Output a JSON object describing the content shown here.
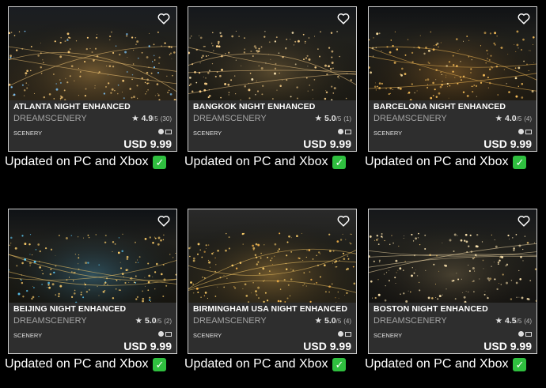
{
  "colors": {
    "background": "#000000",
    "info_bar": "#2e2e2e",
    "check_green": "#2fbf3f",
    "card_border": "#cfcfcf"
  },
  "icons": {
    "favorite": "heart-outline-icon",
    "rating": "star-icon",
    "platform_xbox": "xbox-icon",
    "platform_pc": "pc-monitor-icon",
    "update": "checkmark-icon"
  },
  "products": [
    {
      "title": "ATLANTA NIGHT ENHANCED",
      "vendor": "DREAMSCENERY",
      "rating": "4.9",
      "rating_of": "/5",
      "rating_count": "(30)",
      "category": "SCENERY",
      "price": "USD 9.99",
      "update_note": "Updated on PC and Xbox",
      "check": "✓"
    },
    {
      "title": "BANGKOK NIGHT ENHANCED",
      "vendor": "DREAMSCENERY",
      "rating": "5.0",
      "rating_of": "/5",
      "rating_count": "(1)",
      "category": "SCENERY",
      "price": "USD 9.99",
      "update_note": "Updated on PC and Xbox",
      "check": "✓"
    },
    {
      "title": "BARCELONA NIGHT ENHANCED",
      "vendor": "DREAMSCENERY",
      "rating": "4.0",
      "rating_of": "/5",
      "rating_count": "(4)",
      "category": "SCENERY",
      "price": "USD 9.99",
      "update_note": "Updated on PC and Xbox",
      "check": "✓"
    },
    {
      "title": "BEIJING NIGHT ENHANCED",
      "vendor": "DREAMSCENERY",
      "rating": "5.0",
      "rating_of": "/5",
      "rating_count": "(2)",
      "category": "SCENERY",
      "price": "USD 9.99",
      "update_note": "Updated on PC and Xbox",
      "check": "✓"
    },
    {
      "title": "BIRMINGHAM USA NIGHT ENHANCED",
      "vendor": "DREAMSCENERY",
      "rating": "5.0",
      "rating_of": "/5",
      "rating_count": "(4)",
      "category": "SCENERY",
      "price": "USD 9.99",
      "update_note": "Updated on PC and Xbox",
      "check": "✓"
    },
    {
      "title": "BOSTON NIGHT ENHANCED",
      "vendor": "DREAMSCENERY",
      "rating": "4.5",
      "rating_of": "/5",
      "rating_count": "(4)",
      "category": "SCENERY",
      "price": "USD 9.99",
      "update_note": "Updated on PC and Xbox",
      "check": "✓"
    }
  ]
}
